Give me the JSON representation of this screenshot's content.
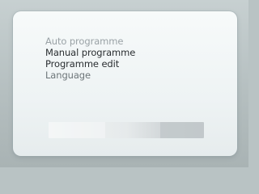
{
  "menu": {
    "items": [
      {
        "label": "Auto programme",
        "state": "dimmed"
      },
      {
        "label": "Manual programme",
        "state": "normal"
      },
      {
        "label": "Programme edit",
        "state": "normal"
      },
      {
        "label": "Language",
        "state": "soft"
      }
    ]
  },
  "colors": {
    "panel": "#f3f7f7",
    "background": "#b9c3c4",
    "text": "#2a2e31",
    "text_dim": "#9aa2a6"
  }
}
